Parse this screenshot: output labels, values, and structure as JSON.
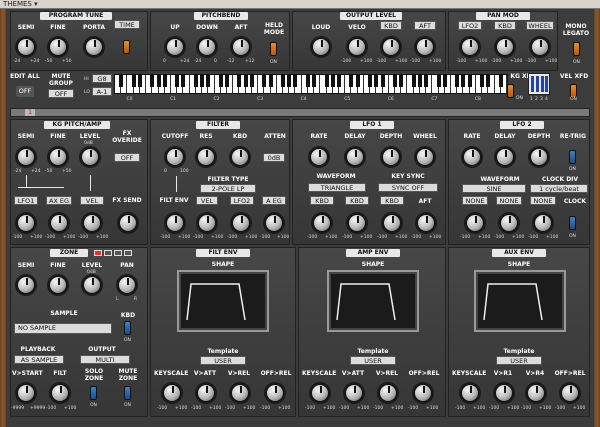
{
  "menu": {
    "themes": "THEMES ▾"
  },
  "program_tune": {
    "title": "PROGRAM TUNE",
    "semi": "SEMI",
    "fine": "FINE",
    "porta": "PORTA",
    "time": "TIME",
    "semi_scale": [
      "-24",
      "+24"
    ],
    "fine_scale": [
      "-50",
      "+50"
    ]
  },
  "pitchbend": {
    "title": "PITCHBEND",
    "up": "UP",
    "down": "DOWN",
    "aft": "AFT",
    "held_mode": "HELD MODE",
    "on": "ON",
    "up_scale": [
      "0",
      "+24"
    ],
    "down_scale": [
      "-24",
      "0"
    ],
    "aft_scale": [
      "-12",
      "+12"
    ]
  },
  "output_level": {
    "title": "OUTPUT LEVEL",
    "loud": "LOUD",
    "velo": "VELO",
    "kbd": "KBD",
    "aft": "AFT",
    "kbd_btn": "KBD",
    "aft_btn": "AFT",
    "scale": [
      "-100",
      "+100"
    ]
  },
  "pan_mod": {
    "title": "PAN MOD",
    "lfo2": "LFO2",
    "kbd": "KBD",
    "wheel": "WHEEL",
    "scale": [
      "-100",
      "+100"
    ],
    "mono_legato": "MONO LEGATO",
    "on": "ON"
  },
  "keyboard_section": {
    "edit_all": "EDIT ALL",
    "off": "OFF",
    "mute_group": "MUTE GROUP",
    "mute_value": "OFF",
    "hi": "HI",
    "lo": "LO",
    "hi_note": "G8",
    "lo_note": "A-1",
    "octaves": [
      "C0",
      "C1",
      "C2",
      "C3",
      "C4",
      "C5",
      "C6",
      "C7",
      "C8"
    ],
    "kg_xfd": "KG XFD",
    "vel_xfd": "VEL XFD",
    "on": "ON",
    "xfd_nums": [
      "1",
      "2",
      "3",
      "4"
    ],
    "strip_marker": "1"
  },
  "kg_pitch_amp": {
    "title": "KG PITCH/AMP",
    "semi": "SEMI",
    "fine": "FINE",
    "level": "LEVEL",
    "level_db": "0dB",
    "fx_override": "FX OVERIDE",
    "fx_value": "OFF",
    "lfo1": "LFO1",
    "ax_eg": "AX EG",
    "vel": "VEL",
    "fx_send": "FX SEND",
    "scale": [
      "-100",
      "+100"
    ],
    "semi_scale": [
      "-24",
      "+24"
    ],
    "fine_scale": [
      "-50",
      "+50"
    ]
  },
  "filter": {
    "title": "FILTER",
    "cutoff": "CUTOFF",
    "res": "RES",
    "kbd": "KBD",
    "atten": "ATTEN",
    "atten_value": "0dB",
    "filter_type": "FILTER TYPE",
    "type_value": "2-POLE LP",
    "filt_env": "FILT ENV",
    "vel": "VEL",
    "lfo2": "LFO2",
    "a_eg": "A EG",
    "scale": [
      "-100",
      "+100"
    ],
    "cutoff_scale": [
      "0",
      "100"
    ]
  },
  "lfo1": {
    "title": "LFO 1",
    "rate": "RATE",
    "delay": "DELAY",
    "depth": "DEPTH",
    "wheel": "WHEEL",
    "waveform": "WAVEFORM",
    "waveform_value": "TRIANGLE",
    "key_sync": "KEY SYNC",
    "key_sync_value": "SYNC OFF",
    "kbd1": "KBD",
    "kbd2": "KBD",
    "kbd3": "KBD",
    "aft": "AFT",
    "scale": [
      "-100",
      "+100"
    ]
  },
  "lfo2": {
    "title": "LFO 2",
    "rate": "RATE",
    "delay": "DELAY",
    "depth": "DEPTH",
    "re_trig": "RE-TRIG",
    "on": "ON",
    "waveform": "WAVEFORM",
    "waveform_value": "SINE",
    "clock_div": "CLOCK DIV",
    "clock_div_value": "1 cycle/beat",
    "clock": "CLOCK",
    "none1": "NONE",
    "none2": "NONE",
    "none3": "NONE",
    "scale": [
      "-100",
      "+100"
    ]
  },
  "zone": {
    "title": "ZONE",
    "semi": "SEMI",
    "fine": "FINE",
    "level": "LEVEL",
    "pan": "PAN",
    "pan_labels": [
      "L",
      "R"
    ],
    "level_db": "0dB",
    "sample": "SAMPLE",
    "sample_value": "NO SAMPLE",
    "kbd": "KBD",
    "on": "ON",
    "playback": "PLAYBACK",
    "playback_value": "AS SAMPLE",
    "output": "OUTPUT",
    "output_value": "MULTI",
    "v_start": "V>START",
    "filt": "FILT",
    "solo_zone": "SOLO ZONE",
    "mute_zone": "MUTE ZONE",
    "scale": [
      "-9999",
      "+9999"
    ],
    "filt_scale": [
      "-100",
      "+100"
    ]
  },
  "filt_env": {
    "title": "FILT ENV",
    "shape": "SHAPE",
    "template": "Template",
    "template_value": "USER",
    "keyscale": "KEYSCALE",
    "v_att": "V>ATT",
    "v_rel": "V>REL",
    "off_rel": "OFF>REL",
    "scale": [
      "-100",
      "+100"
    ]
  },
  "amp_env": {
    "title": "AMP ENV",
    "shape": "SHAPE",
    "template": "Template",
    "template_value": "USER",
    "keyscale": "KEYSCALE",
    "v_att": "V>ATT",
    "v_rel": "V>REL",
    "off_rel": "OFF>REL",
    "scale": [
      "-100",
      "+100"
    ]
  },
  "aux_env": {
    "title": "AUX ENV",
    "shape": "SHAPE",
    "template": "Template",
    "template_value": "USER",
    "keyscale": "KEYSCALE",
    "v_r1": "V>R1",
    "v_r4": "V>R4",
    "off_rel": "OFF>REL",
    "scale": [
      "-100",
      "+100"
    ]
  },
  "colors": {
    "frame": "#6a4423",
    "panel": "#3c3c3c",
    "display": "#dcdcdc",
    "toggle_orange": "#f08a2a",
    "toggle_blue": "#3a82c8"
  }
}
